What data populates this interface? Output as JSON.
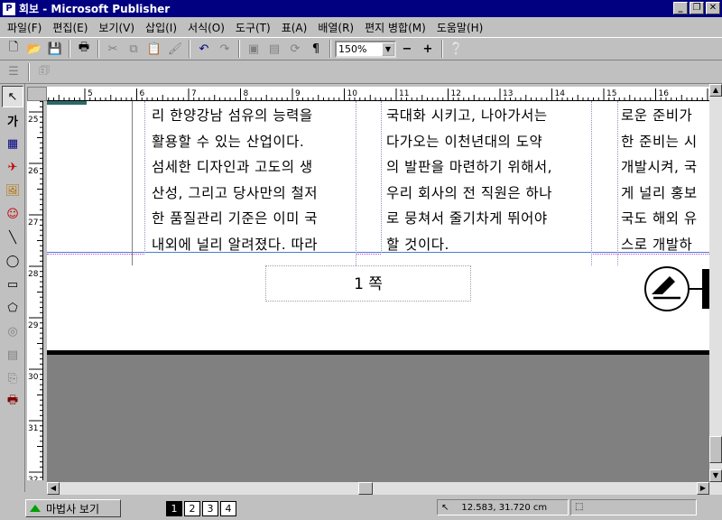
{
  "title": "회보 - Microsoft Publisher",
  "menu": [
    "파일(F)",
    "편집(E)",
    "보기(V)",
    "삽입(I)",
    "서식(O)",
    "도구(T)",
    "표(A)",
    "배열(R)",
    "편지 병합(M)",
    "도움말(H)"
  ],
  "toolbar": {
    "zoom_value": "150%"
  },
  "ruler": {
    "h_labels": [
      "5",
      "6",
      "7",
      "8",
      "9",
      "10",
      "11",
      "12",
      "13",
      "14",
      "15",
      "16"
    ],
    "v_labels": [
      "25",
      "26",
      "27",
      "28",
      "29",
      "30",
      "31",
      "32"
    ]
  },
  "columns": [
    [
      "리 한양강남 섬유의 능력을",
      "활용할 수 있는 산업이다.",
      "섬세한 디자인과 고도의 생",
      "산성, 그리고 당사만의 철저",
      "한 품질관리 기준은 이미 국",
      "내외에 널리 알려졌다. 따라"
    ],
    [
      "국대화 시키고, 나아가서는",
      "다가오는 이천년대의 도약",
      "의 발판을 마련하기 위해서,",
      "우리 회사의 전 직원은 하나",
      "로 뭉쳐서 줄기차게 뛰어야",
      "할 것이다."
    ],
    [
      "로운 준비가",
      "한 준비는 시",
      "개발시켜, 국",
      "게 널리 홍보",
      "국도 해외 유",
      "스로 개발하"
    ]
  ],
  "page_number_text": "1 쪽",
  "status": {
    "wizard_label": "마법사 보기",
    "pages": [
      "1",
      "2",
      "3",
      "4"
    ],
    "active_page": "1",
    "coords": "12.583, 31.720 cm"
  }
}
